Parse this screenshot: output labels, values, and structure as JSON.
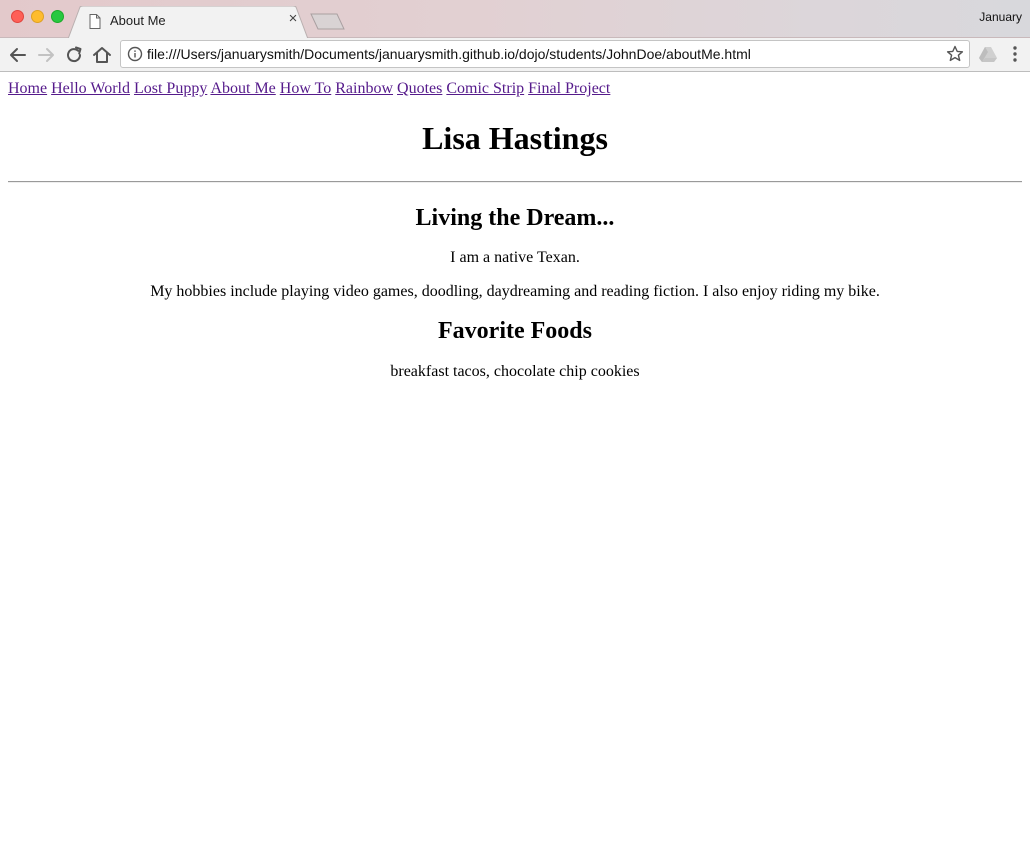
{
  "browser": {
    "tab_title": "About Me",
    "tab_close": "×",
    "profile_name": "January",
    "url": "file:///Users/januarysmith/Documents/januarysmith.github.io/dojo/students/JohnDoe/aboutMe.html",
    "icons": [
      "back-icon",
      "forward-icon",
      "reload-icon",
      "home-icon",
      "info-icon",
      "star-icon",
      "extension-icon",
      "menu-icon"
    ]
  },
  "nav": {
    "links": [
      "Home",
      "Hello World",
      "Lost Puppy",
      "About Me",
      "How To",
      "Rainbow",
      "Quotes",
      "Comic Strip",
      "Final Project"
    ]
  },
  "content": {
    "title": "Lisa Hastings",
    "section1_heading": "Living the Dream...",
    "para1": "I am a native Texan.",
    "para2": "My hobbies include playing video games, doodling, daydreaming and reading fiction. I also enjoy riding my bike.",
    "section2_heading": "Favorite Foods",
    "para3": "breakfast tacos, chocolate chip cookies"
  },
  "colors": {
    "link": "#551a8b",
    "titlebar": "#e3c9cb",
    "toolbar": "#f2f2f2"
  }
}
